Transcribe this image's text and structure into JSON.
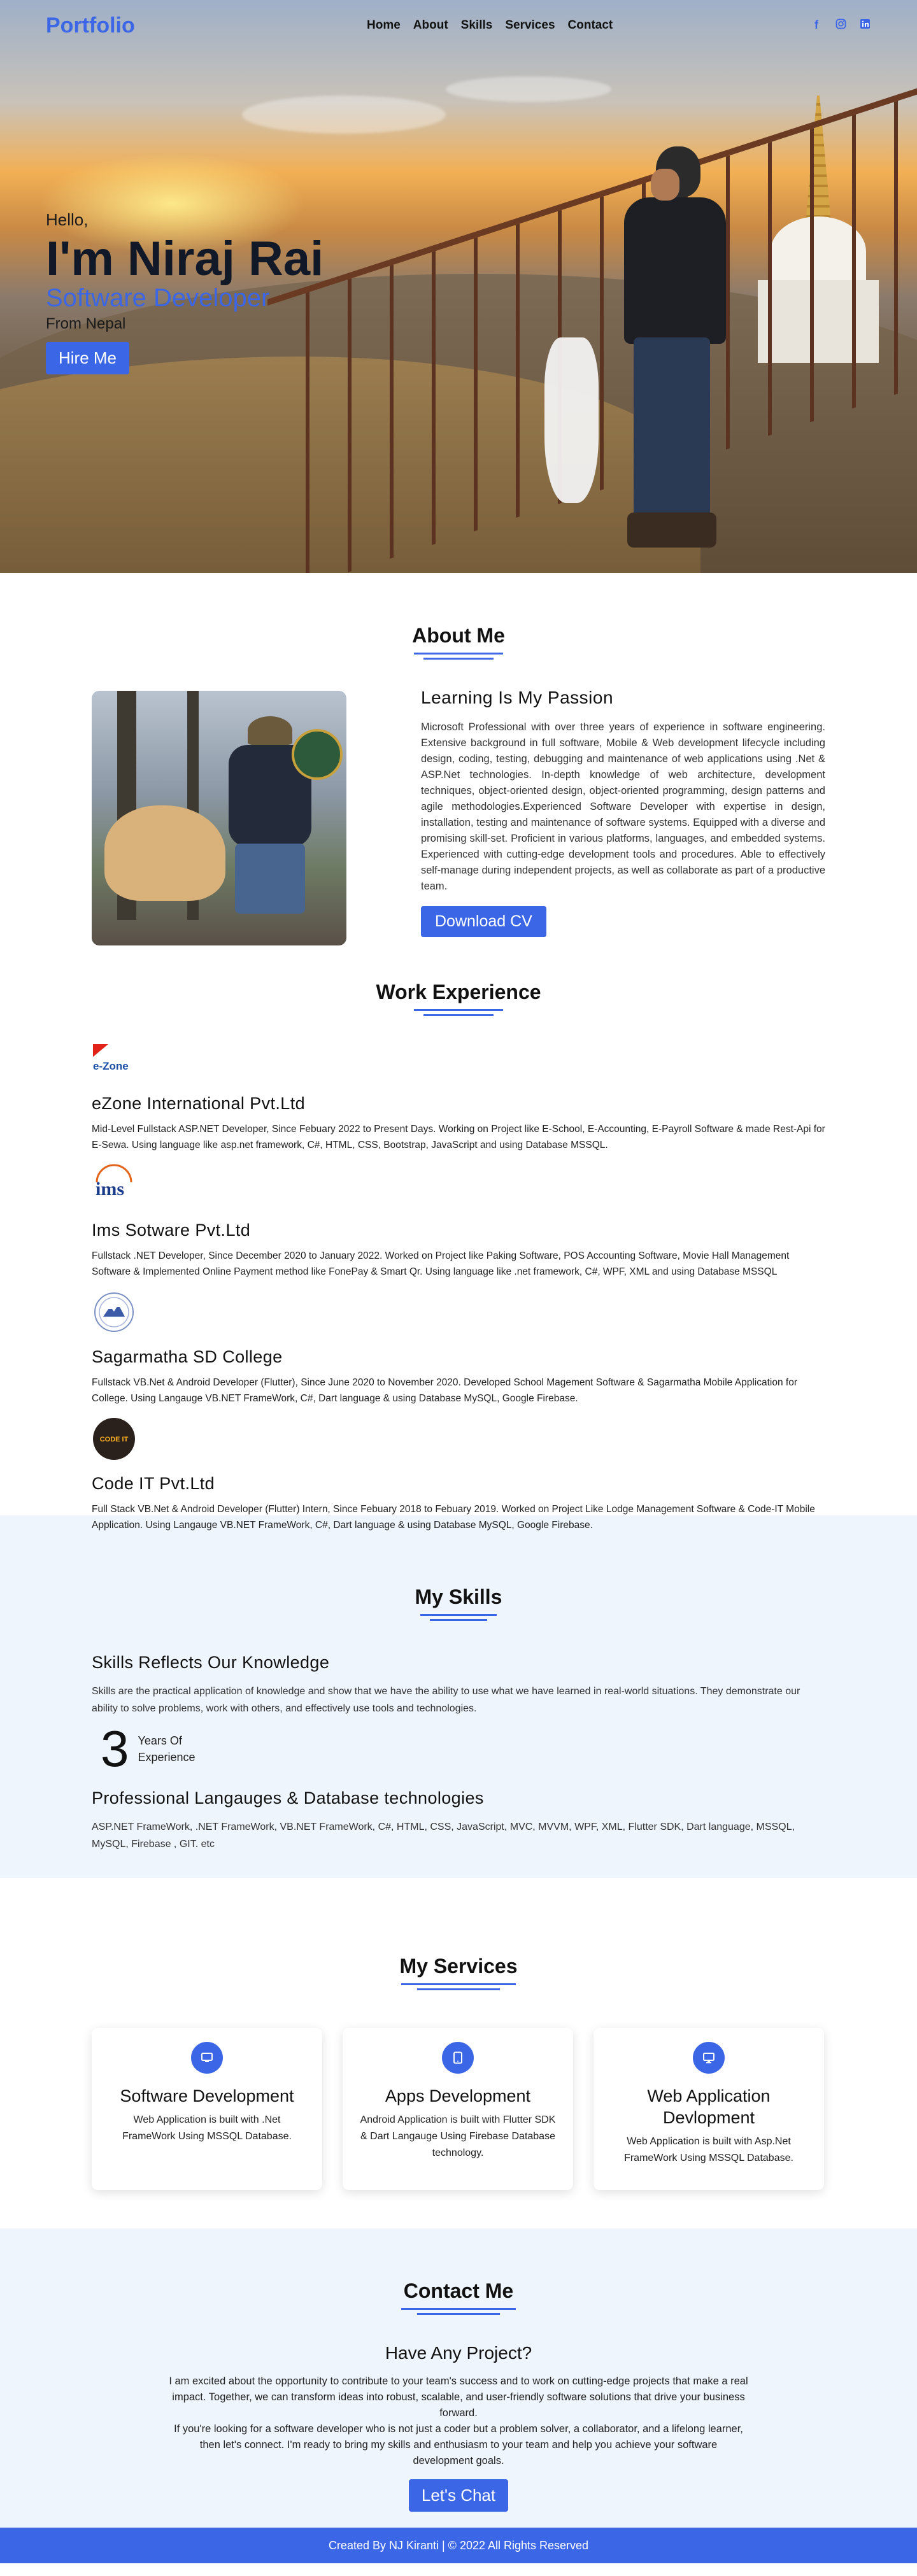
{
  "nav": {
    "logo": "Portfolio",
    "links": [
      "Home",
      "About",
      "Skills",
      "Services",
      "Contact"
    ],
    "social_icons": [
      "facebook-icon",
      "instagram-icon",
      "linkedin-icon"
    ]
  },
  "hero": {
    "greeting": "Hello,",
    "name": "I'm Niraj Rai",
    "role": "Software Developer",
    "location": "From Nepal",
    "cta": "Hire Me"
  },
  "about": {
    "title": "About Me",
    "heading": "Learning Is My Passion",
    "text": "Microsoft Professional with over three years of experience in software engineering. Extensive background in full software, Mobile & Web development lifecycle including design, coding, testing, debugging and maintenance of web applications using .Net & ASP.Net technologies. In-depth knowledge of web architecture, development techniques, object-oriented design, object-oriented programming, design patterns and agile methodologies.Experienced Software Developer with expertise in design, installation, testing and maintenance of software systems. Equipped with a diverse and promising skill-set. Proficient in various platforms, languages, and embedded systems. Experienced with cutting-edge development tools and procedures. Able to effectively self-manage during independent projects, as well as collaborate as part of a productive team.",
    "cta": "Download CV"
  },
  "experience": {
    "title": "Work Experience",
    "items": [
      {
        "logo_text": "e-Zone",
        "company": "eZone International Pvt.Ltd",
        "description": "Mid-Level Fullstack ASP.NET Developer, Since Febuary 2022 to Present Days. Working on Project like E-School, E-Accounting, E-Payroll Software & made Rest-Api for E-Sewa. Using language like asp.net framework, C#, HTML, CSS, Bootstrap, JavaScript and using Database MSSQL."
      },
      {
        "logo_text": "ims",
        "company": "Ims Sotware Pvt.Ltd",
        "description": "Fullstack .NET Developer, Since December 2020 to January 2022. Worked on Project like Paking Software, POS Accounting Software, Movie Hall Management Software & Implemented Online Payment method like FonePay & Smart Qr. Using language like .net framework, C#, WPF, XML and using Database MSSQL"
      },
      {
        "logo_text": "",
        "company": "Sagarmatha SD College",
        "description": "Fullstack VB.Net & Android Developer (Flutter), Since June 2020 to November 2020. Developed School Magement Software & Sagarmatha Mobile Application for College. Using Langauge VB.NET FrameWork, C#, Dart language & using Database MySQL, Google Firebase."
      },
      {
        "logo_text": "CODE IT",
        "company": "Code IT Pvt.Ltd",
        "description": "Full Stack VB.Net & Android Developer (Flutter) Intern, Since Febuary 2018 to Febuary 2019. Worked on Project Like Lodge Management Software & Code-IT Mobile Application. Using Langauge VB.NET FrameWork, C#, Dart language & using Database MySQL, Google Firebase."
      }
    ]
  },
  "skills": {
    "title": "My Skills",
    "heading": "Skills Reflects Our Knowledge",
    "text": "Skills are the practical application of knowledge and show that we have the ability to use what we have learned in real-world situations. They demonstrate our ability to solve problems, work with others, and effectively use tools and technologies.",
    "years_number": "3",
    "years_label_1": "Years Of",
    "years_label_2": "Experience",
    "tech_heading": "Professional Langauges & Database technologies",
    "tech_list": "ASP.NET FrameWork, .NET FrameWork, VB.NET FrameWork, C#, HTML, CSS, JavaScript, MVC, MVVM, WPF, XML, Flutter SDK, Dart language, MSSQL, MySQL, Firebase , GIT. etc"
  },
  "services": {
    "title": "My Services",
    "cards": [
      {
        "icon": "monitor-icon",
        "title": "Software Development",
        "text": "Web Application is built with .Net FrameWork Using MSSQL Database."
      },
      {
        "icon": "tablet-icon",
        "title": "Apps Development",
        "text": "Android Application is built with Flutter SDK & Dart Langauge Using Firebase Database technology."
      },
      {
        "icon": "desktop-icon",
        "title": "Web Application Devlopment",
        "text": "Web Application is built with Asp.Net FrameWork Using MSSQL Database."
      }
    ]
  },
  "contact": {
    "title": "Contact Me",
    "heading": "Have Any Project?",
    "text_1": "I am excited about the opportunity to contribute to your team's success and to work on cutting-edge projects that make a real impact. Together, we can transform ideas into robust, scalable, and user-friendly software solutions that drive your business forward.",
    "text_2": "If you're looking for a software developer who is not just a coder but a problem solver, a collaborator, and a lifelong learner, then let's connect. I'm ready to bring my skills and enthusiasm to your team and help you achieve your software development goals.",
    "cta": "Let's Chat"
  },
  "footer": {
    "text": "Created By NJ Kiranti | © 2022 All Rights Reserved"
  },
  "colors": {
    "accent": "#3b66e6",
    "light_bg": "#eef5fd"
  }
}
